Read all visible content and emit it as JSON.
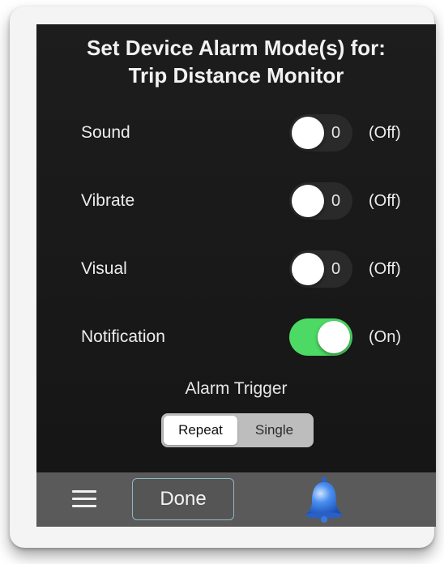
{
  "title": {
    "line1": "Set Device Alarm Mode(s) for:",
    "line2": "Trip Distance Monitor"
  },
  "alarm_modes": [
    {
      "label": "Sound",
      "value": "0",
      "state": "(Off)",
      "on": false
    },
    {
      "label": "Vibrate",
      "value": "0",
      "state": "(Off)",
      "on": false
    },
    {
      "label": "Visual",
      "value": "0",
      "state": "(Off)",
      "on": false
    },
    {
      "label": "Notification",
      "value": "",
      "state": "(On)",
      "on": true
    }
  ],
  "trigger": {
    "label": "Alarm Trigger",
    "options": [
      "Repeat",
      "Single"
    ],
    "selected": "Repeat"
  },
  "toolbar": {
    "menu_icon": "hamburger-icon",
    "done_label": "Done",
    "bell_icon": "bell-icon"
  },
  "colors": {
    "toggle_on": "#4cd964",
    "background": "#1a1a1a",
    "toolbar": "#5a5a5a"
  }
}
